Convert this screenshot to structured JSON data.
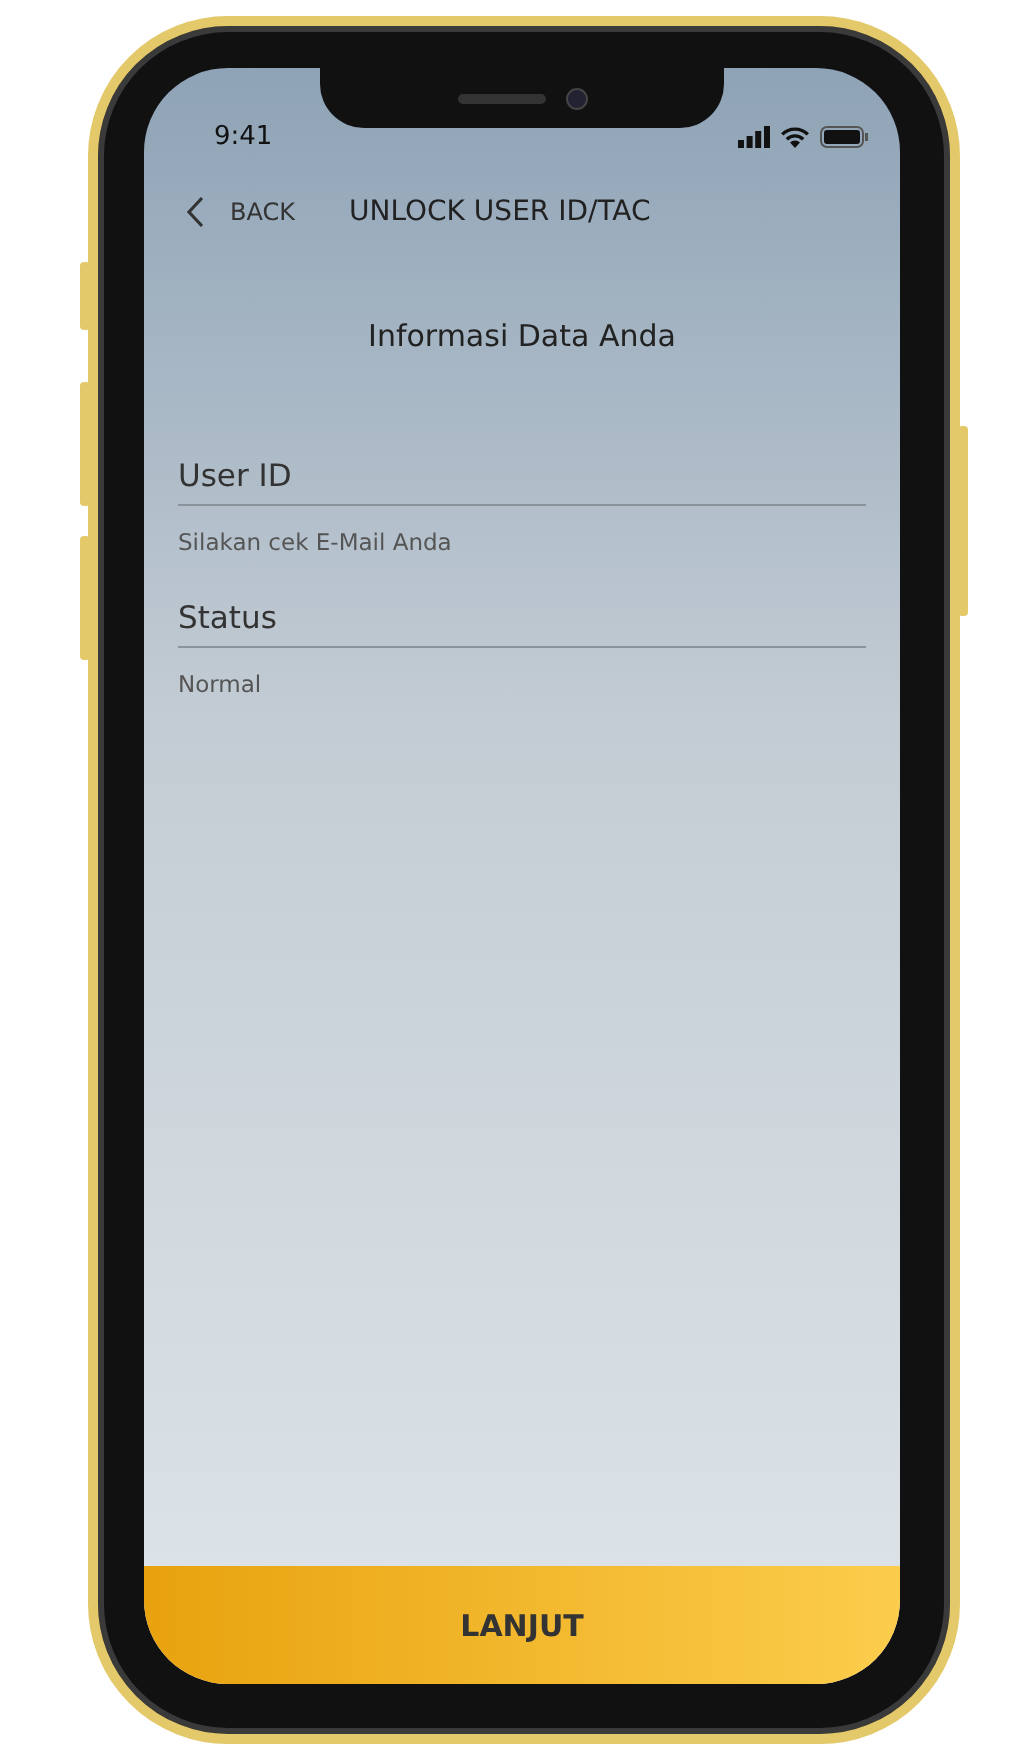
{
  "status_bar": {
    "time": "9:41"
  },
  "header": {
    "back_label": "BACK",
    "title": "UNLOCK USER ID/TAC"
  },
  "section_title": "Informasi Data Anda",
  "fields": [
    {
      "label": "User ID",
      "value": "Silakan cek E-Mail Anda"
    },
    {
      "label": "Status",
      "value": "Normal"
    }
  ],
  "primary_button": {
    "label": "LANJUT"
  }
}
